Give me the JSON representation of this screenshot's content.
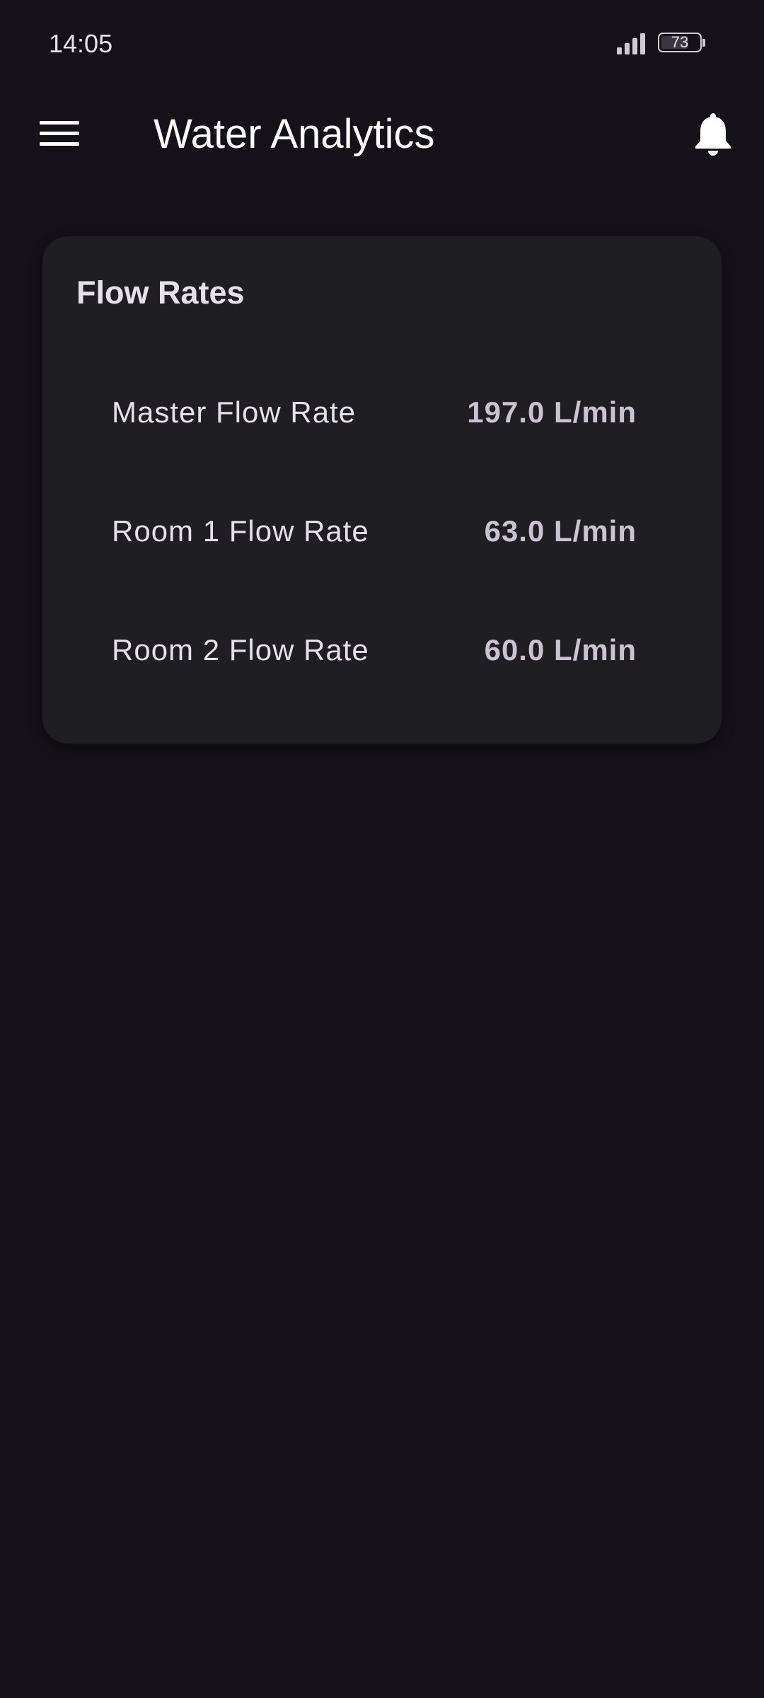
{
  "status_bar": {
    "time": "14:05",
    "battery_level": "73",
    "battery_fraction": 0.73,
    "signal_icon": "signal-bars-icon",
    "battery_icon": "battery-icon"
  },
  "app_bar": {
    "title": "Water Analytics",
    "menu_icon": "hamburger-menu-icon",
    "notifications_icon": "bell-icon"
  },
  "flow_card": {
    "title": "Flow Rates",
    "rows": [
      {
        "label": "Master Flow Rate",
        "value": "197.0 L/min"
      },
      {
        "label": "Room 1 Flow Rate",
        "value": "63.0 L/min"
      },
      {
        "label": "Room 2 Flow Rate",
        "value": "60.0 L/min"
      }
    ]
  },
  "colors": {
    "background": "#141218",
    "card": "#1F1E22",
    "text_primary": "#E6E0E9",
    "text_value": "#CAC4D0"
  }
}
